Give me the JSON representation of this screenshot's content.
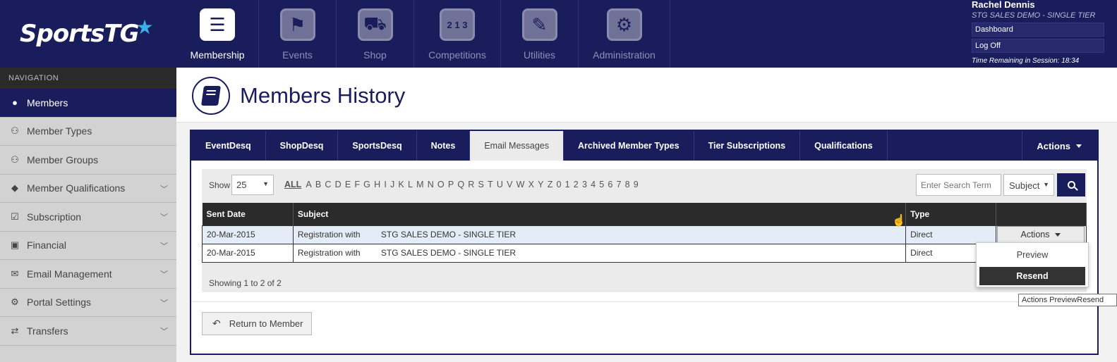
{
  "brand": {
    "logo_text": "SportsTG"
  },
  "modules": [
    {
      "label": "Membership",
      "icon": "membership-icon",
      "active": true
    },
    {
      "label": "Events",
      "icon": "events-icon",
      "active": false
    },
    {
      "label": "Shop",
      "icon": "shop-cart-icon",
      "active": false
    },
    {
      "label": "Competitions",
      "icon": "podium-icon",
      "active": false
    },
    {
      "label": "Utilities",
      "icon": "wrench-icon",
      "active": false
    },
    {
      "label": "Administration",
      "icon": "gear-icon",
      "active": false
    }
  ],
  "user": {
    "name": "Rachel Dennis",
    "org": "STG SALES DEMO - SINGLE TIER",
    "dashboard": "Dashboard",
    "logoff": "Log Off",
    "session": "Time Remaining in Session: 18:34"
  },
  "sidebar": {
    "title": "NAVIGATION",
    "items": [
      {
        "label": "Members",
        "icon": "user-icon",
        "active": true,
        "chevron": false
      },
      {
        "label": "Member Types",
        "icon": "users-icon",
        "active": false,
        "chevron": false
      },
      {
        "label": "Member Groups",
        "icon": "group-icon",
        "active": false,
        "chevron": false
      },
      {
        "label": "Member Qualifications",
        "icon": "tags-icon",
        "active": false,
        "chevron": true
      },
      {
        "label": "Subscription",
        "icon": "checkbox-icon",
        "active": false,
        "chevron": true
      },
      {
        "label": "Financial",
        "icon": "money-icon",
        "active": false,
        "chevron": true
      },
      {
        "label": "Email Management",
        "icon": "envelope-icon",
        "active": false,
        "chevron": true
      },
      {
        "label": "Portal Settings",
        "icon": "cogs-icon",
        "active": false,
        "chevron": true
      },
      {
        "label": "Transfers",
        "icon": "exchange-icon",
        "active": false,
        "chevron": true
      }
    ]
  },
  "page": {
    "title": "Members History"
  },
  "tabs": [
    {
      "label": "EventDesq",
      "active": false
    },
    {
      "label": "ShopDesq",
      "active": false
    },
    {
      "label": "SportsDesq",
      "active": false
    },
    {
      "label": "Notes",
      "active": false
    },
    {
      "label": "Email Messages",
      "active": true
    },
    {
      "label": "Archived Member Types",
      "active": false
    },
    {
      "label": "Tier Subscriptions",
      "active": false
    },
    {
      "label": "Qualifications",
      "active": false
    }
  ],
  "tab_actions": "Actions",
  "controls": {
    "show_label": "Show",
    "show_value": "25",
    "alpha_all": "ALL",
    "alpha": [
      "A",
      "B",
      "C",
      "D",
      "E",
      "F",
      "G",
      "H",
      "I",
      "J",
      "K",
      "L",
      "M",
      "N",
      "O",
      "P",
      "Q",
      "R",
      "S",
      "T",
      "U",
      "V",
      "W",
      "X",
      "Y",
      "Z",
      "0",
      "1",
      "2",
      "3",
      "4",
      "5",
      "6",
      "7",
      "8",
      "9"
    ],
    "search_placeholder": "Enter Search Term",
    "filter_value": "Subject"
  },
  "table": {
    "columns": [
      "Sent Date",
      "Subject",
      "Type",
      ""
    ],
    "rows": [
      {
        "date": "20-Mar-2015",
        "subject_a": "Registration with",
        "subject_b": "STG SALES DEMO - SINGLE TIER",
        "type": "Direct",
        "action": "Actions"
      },
      {
        "date": "20-Mar-2015",
        "subject_a": "Registration with",
        "subject_b": "STG SALES DEMO - SINGLE TIER",
        "type": "Direct",
        "action": ""
      }
    ]
  },
  "footer": {
    "showing": "Showing 1 to 2 of 2"
  },
  "dropdown": {
    "items": [
      "Preview",
      "Resend"
    ]
  },
  "return_button": "Return to Member",
  "tooltip": "Actions PreviewResend",
  "colors": {
    "primary": "#1a1d5c",
    "accent": "#3bb0e8"
  }
}
